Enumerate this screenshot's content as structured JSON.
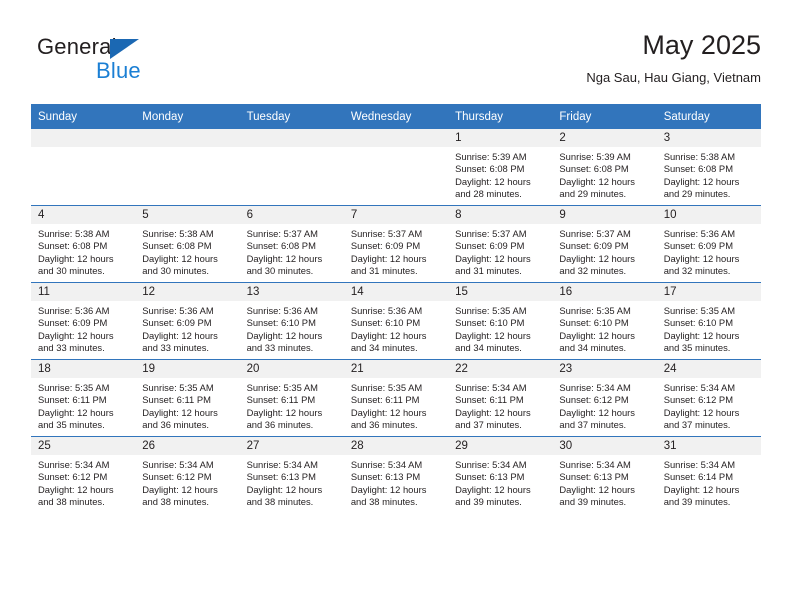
{
  "brand": {
    "name_top": "General",
    "name_bottom": "Blue",
    "accent_color": "#1b7fd4",
    "triangle_color": "#1b68b3"
  },
  "header": {
    "title": "May 2025",
    "subtitle": "Nga Sau, Hau Giang, Vietnam"
  },
  "calendar": {
    "header_bg": "#3275bc",
    "daynum_bg": "#f1f1f1",
    "weekday_headers": [
      "Sunday",
      "Monday",
      "Tuesday",
      "Wednesday",
      "Thursday",
      "Friday",
      "Saturday"
    ],
    "weeks": [
      [
        {
          "day": "",
          "sunrise": "",
          "sunset": "",
          "daylight_line1": "",
          "daylight_line2": ""
        },
        {
          "day": "",
          "sunrise": "",
          "sunset": "",
          "daylight_line1": "",
          "daylight_line2": ""
        },
        {
          "day": "",
          "sunrise": "",
          "sunset": "",
          "daylight_line1": "",
          "daylight_line2": ""
        },
        {
          "day": "",
          "sunrise": "",
          "sunset": "",
          "daylight_line1": "",
          "daylight_line2": ""
        },
        {
          "day": "1",
          "sunrise": "Sunrise: 5:39 AM",
          "sunset": "Sunset: 6:08 PM",
          "daylight_line1": "Daylight: 12 hours",
          "daylight_line2": "and 28 minutes."
        },
        {
          "day": "2",
          "sunrise": "Sunrise: 5:39 AM",
          "sunset": "Sunset: 6:08 PM",
          "daylight_line1": "Daylight: 12 hours",
          "daylight_line2": "and 29 minutes."
        },
        {
          "day": "3",
          "sunrise": "Sunrise: 5:38 AM",
          "sunset": "Sunset: 6:08 PM",
          "daylight_line1": "Daylight: 12 hours",
          "daylight_line2": "and 29 minutes."
        }
      ],
      [
        {
          "day": "4",
          "sunrise": "Sunrise: 5:38 AM",
          "sunset": "Sunset: 6:08 PM",
          "daylight_line1": "Daylight: 12 hours",
          "daylight_line2": "and 30 minutes."
        },
        {
          "day": "5",
          "sunrise": "Sunrise: 5:38 AM",
          "sunset": "Sunset: 6:08 PM",
          "daylight_line1": "Daylight: 12 hours",
          "daylight_line2": "and 30 minutes."
        },
        {
          "day": "6",
          "sunrise": "Sunrise: 5:37 AM",
          "sunset": "Sunset: 6:08 PM",
          "daylight_line1": "Daylight: 12 hours",
          "daylight_line2": "and 30 minutes."
        },
        {
          "day": "7",
          "sunrise": "Sunrise: 5:37 AM",
          "sunset": "Sunset: 6:09 PM",
          "daylight_line1": "Daylight: 12 hours",
          "daylight_line2": "and 31 minutes."
        },
        {
          "day": "8",
          "sunrise": "Sunrise: 5:37 AM",
          "sunset": "Sunset: 6:09 PM",
          "daylight_line1": "Daylight: 12 hours",
          "daylight_line2": "and 31 minutes."
        },
        {
          "day": "9",
          "sunrise": "Sunrise: 5:37 AM",
          "sunset": "Sunset: 6:09 PM",
          "daylight_line1": "Daylight: 12 hours",
          "daylight_line2": "and 32 minutes."
        },
        {
          "day": "10",
          "sunrise": "Sunrise: 5:36 AM",
          "sunset": "Sunset: 6:09 PM",
          "daylight_line1": "Daylight: 12 hours",
          "daylight_line2": "and 32 minutes."
        }
      ],
      [
        {
          "day": "11",
          "sunrise": "Sunrise: 5:36 AM",
          "sunset": "Sunset: 6:09 PM",
          "daylight_line1": "Daylight: 12 hours",
          "daylight_line2": "and 33 minutes."
        },
        {
          "day": "12",
          "sunrise": "Sunrise: 5:36 AM",
          "sunset": "Sunset: 6:09 PM",
          "daylight_line1": "Daylight: 12 hours",
          "daylight_line2": "and 33 minutes."
        },
        {
          "day": "13",
          "sunrise": "Sunrise: 5:36 AM",
          "sunset": "Sunset: 6:10 PM",
          "daylight_line1": "Daylight: 12 hours",
          "daylight_line2": "and 33 minutes."
        },
        {
          "day": "14",
          "sunrise": "Sunrise: 5:36 AM",
          "sunset": "Sunset: 6:10 PM",
          "daylight_line1": "Daylight: 12 hours",
          "daylight_line2": "and 34 minutes."
        },
        {
          "day": "15",
          "sunrise": "Sunrise: 5:35 AM",
          "sunset": "Sunset: 6:10 PM",
          "daylight_line1": "Daylight: 12 hours",
          "daylight_line2": "and 34 minutes."
        },
        {
          "day": "16",
          "sunrise": "Sunrise: 5:35 AM",
          "sunset": "Sunset: 6:10 PM",
          "daylight_line1": "Daylight: 12 hours",
          "daylight_line2": "and 34 minutes."
        },
        {
          "day": "17",
          "sunrise": "Sunrise: 5:35 AM",
          "sunset": "Sunset: 6:10 PM",
          "daylight_line1": "Daylight: 12 hours",
          "daylight_line2": "and 35 minutes."
        }
      ],
      [
        {
          "day": "18",
          "sunrise": "Sunrise: 5:35 AM",
          "sunset": "Sunset: 6:11 PM",
          "daylight_line1": "Daylight: 12 hours",
          "daylight_line2": "and 35 minutes."
        },
        {
          "day": "19",
          "sunrise": "Sunrise: 5:35 AM",
          "sunset": "Sunset: 6:11 PM",
          "daylight_line1": "Daylight: 12 hours",
          "daylight_line2": "and 36 minutes."
        },
        {
          "day": "20",
          "sunrise": "Sunrise: 5:35 AM",
          "sunset": "Sunset: 6:11 PM",
          "daylight_line1": "Daylight: 12 hours",
          "daylight_line2": "and 36 minutes."
        },
        {
          "day": "21",
          "sunrise": "Sunrise: 5:35 AM",
          "sunset": "Sunset: 6:11 PM",
          "daylight_line1": "Daylight: 12 hours",
          "daylight_line2": "and 36 minutes."
        },
        {
          "day": "22",
          "sunrise": "Sunrise: 5:34 AM",
          "sunset": "Sunset: 6:11 PM",
          "daylight_line1": "Daylight: 12 hours",
          "daylight_line2": "and 37 minutes."
        },
        {
          "day": "23",
          "sunrise": "Sunrise: 5:34 AM",
          "sunset": "Sunset: 6:12 PM",
          "daylight_line1": "Daylight: 12 hours",
          "daylight_line2": "and 37 minutes."
        },
        {
          "day": "24",
          "sunrise": "Sunrise: 5:34 AM",
          "sunset": "Sunset: 6:12 PM",
          "daylight_line1": "Daylight: 12 hours",
          "daylight_line2": "and 37 minutes."
        }
      ],
      [
        {
          "day": "25",
          "sunrise": "Sunrise: 5:34 AM",
          "sunset": "Sunset: 6:12 PM",
          "daylight_line1": "Daylight: 12 hours",
          "daylight_line2": "and 38 minutes."
        },
        {
          "day": "26",
          "sunrise": "Sunrise: 5:34 AM",
          "sunset": "Sunset: 6:12 PM",
          "daylight_line1": "Daylight: 12 hours",
          "daylight_line2": "and 38 minutes."
        },
        {
          "day": "27",
          "sunrise": "Sunrise: 5:34 AM",
          "sunset": "Sunset: 6:13 PM",
          "daylight_line1": "Daylight: 12 hours",
          "daylight_line2": "and 38 minutes."
        },
        {
          "day": "28",
          "sunrise": "Sunrise: 5:34 AM",
          "sunset": "Sunset: 6:13 PM",
          "daylight_line1": "Daylight: 12 hours",
          "daylight_line2": "and 38 minutes."
        },
        {
          "day": "29",
          "sunrise": "Sunrise: 5:34 AM",
          "sunset": "Sunset: 6:13 PM",
          "daylight_line1": "Daylight: 12 hours",
          "daylight_line2": "and 39 minutes."
        },
        {
          "day": "30",
          "sunrise": "Sunrise: 5:34 AM",
          "sunset": "Sunset: 6:13 PM",
          "daylight_line1": "Daylight: 12 hours",
          "daylight_line2": "and 39 minutes."
        },
        {
          "day": "31",
          "sunrise": "Sunrise: 5:34 AM",
          "sunset": "Sunset: 6:14 PM",
          "daylight_line1": "Daylight: 12 hours",
          "daylight_line2": "and 39 minutes."
        }
      ]
    ]
  }
}
